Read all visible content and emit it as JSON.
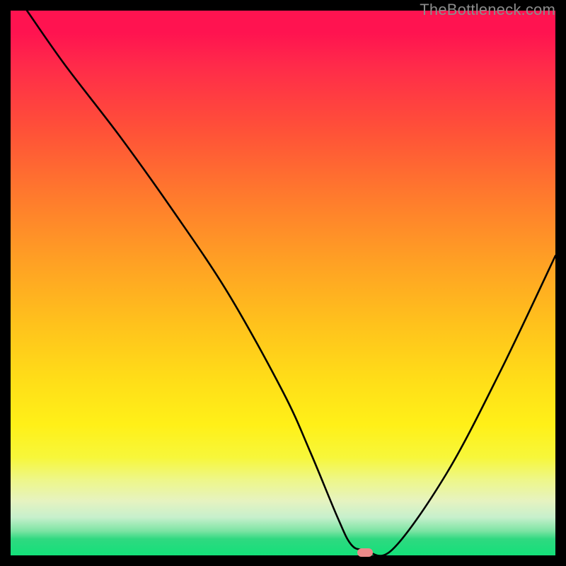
{
  "watermark": "TheBottleneck.com",
  "chart_data": {
    "type": "line",
    "title": "",
    "xlabel": "",
    "ylabel": "",
    "xlim": [
      0,
      100
    ],
    "ylim": [
      0,
      100
    ],
    "grid": false,
    "series": [
      {
        "name": "curve",
        "x": [
          3,
          10,
          20,
          30,
          40,
          50,
          55,
          60,
          62.5,
          65,
          70,
          80,
          90,
          100
        ],
        "values": [
          100,
          90,
          77,
          63,
          48,
          30,
          19,
          7,
          2,
          1,
          1,
          15,
          34,
          55
        ]
      }
    ],
    "marker": {
      "x": 65,
      "y": 0.5,
      "color": "#eb8a8a"
    },
    "gradient": {
      "top": "#ff1350",
      "mid": "#ffde18",
      "bottom": "#13e07a"
    }
  }
}
